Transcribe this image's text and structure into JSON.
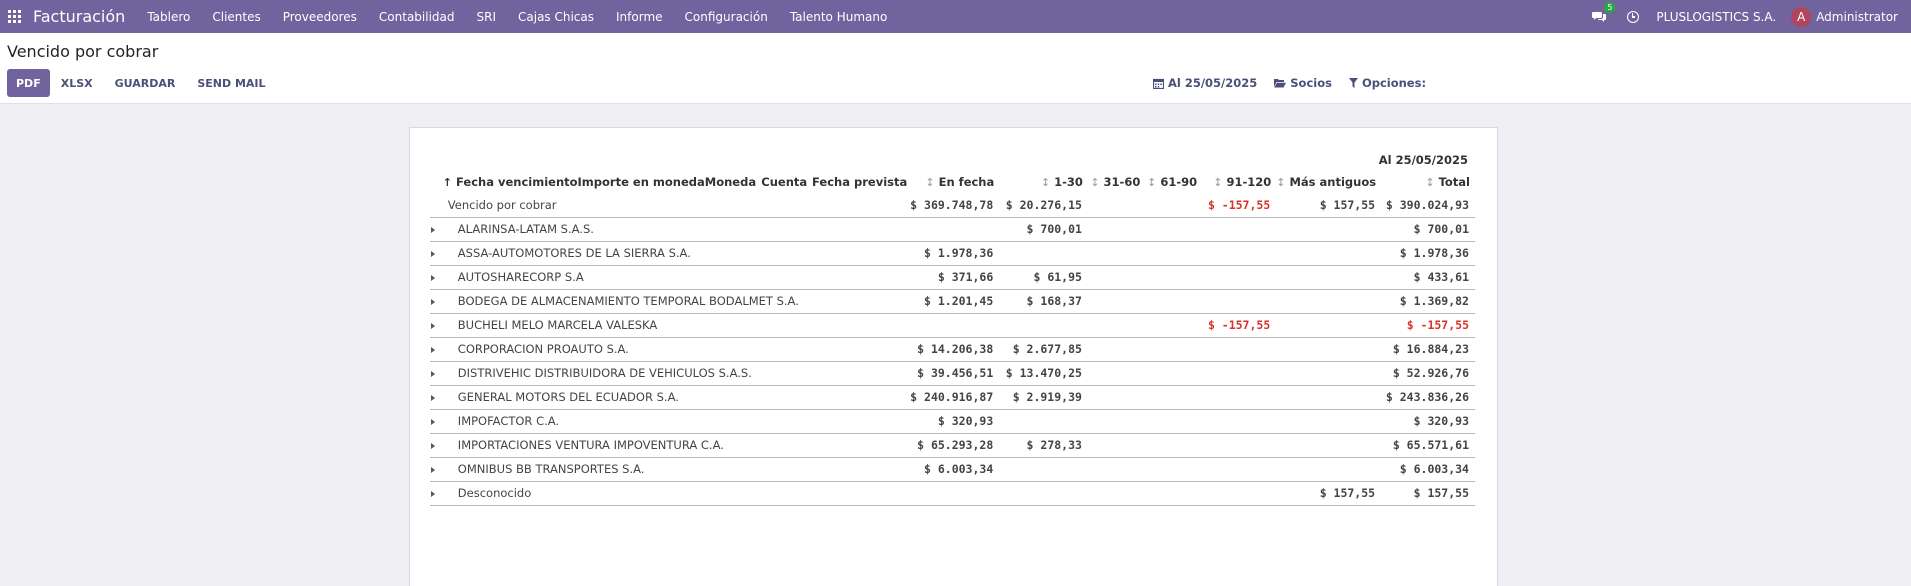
{
  "navbar": {
    "brand": "Facturación",
    "menu": [
      "Tablero",
      "Clientes",
      "Proveedores",
      "Contabilidad",
      "SRI",
      "Cajas Chicas",
      "Informe",
      "Configuración",
      "Talento Humano"
    ],
    "message_count": "5",
    "company": "PLUSLOGISTICS S.A.",
    "avatar_letter": "A",
    "user": "Administrator"
  },
  "control_panel": {
    "title": "Vencido por cobrar",
    "buttons": [
      "PDF",
      "XLSX",
      "GUARDAR",
      "SEND MAIL"
    ],
    "date_filter": "Al 25/05/2025",
    "partners_filter": "Socios",
    "options_filter": "Opciones:"
  },
  "report": {
    "as_of": "Al 25/05/2025",
    "columns": [
      "Fecha vencimiento",
      "Importe en moneda",
      "Moneda",
      "Cuenta",
      "Fecha prevista",
      "En fecha",
      "1-30",
      "31-60",
      "61-90",
      "91-120",
      "Más antiguos",
      "Total"
    ],
    "summary": {
      "name": "Vencido por cobrar",
      "values": [
        "$ 369.748,78",
        "$ 20.276,15",
        "",
        "",
        "$ -157,55",
        "$ 157,55",
        "$ 390.024,93"
      ]
    },
    "rows": [
      {
        "name": "ALARINSA-LATAM S.A.S.",
        "values": [
          "",
          "$ 700,01",
          "",
          "",
          "",
          "",
          "$ 700,01"
        ]
      },
      {
        "name": "ASSA-AUTOMOTORES DE LA SIERRA S.A.",
        "values": [
          "$ 1.978,36",
          "",
          "",
          "",
          "",
          "",
          "$ 1.978,36"
        ]
      },
      {
        "name": "AUTOSHARECORP S.A",
        "values": [
          "$ 371,66",
          "$ 61,95",
          "",
          "",
          "",
          "",
          "$ 433,61"
        ]
      },
      {
        "name": "BODEGA DE ALMACENAMIENTO TEMPORAL BODALMET S.A.",
        "values": [
          "$ 1.201,45",
          "$ 168,37",
          "",
          "",
          "",
          "",
          "$ 1.369,82"
        ]
      },
      {
        "name": "BUCHELI MELO MARCELA VALESKA",
        "values": [
          "",
          "",
          "",
          "",
          "$ -157,55",
          "",
          "$ -157,55"
        ]
      },
      {
        "name": "CORPORACION PROAUTO S.A.",
        "values": [
          "$ 14.206,38",
          "$ 2.677,85",
          "",
          "",
          "",
          "",
          "$ 16.884,23"
        ]
      },
      {
        "name": "DISTRIVEHIC DISTRIBUIDORA DE VEHICULOS S.A.S.",
        "values": [
          "$ 39.456,51",
          "$ 13.470,25",
          "",
          "",
          "",
          "",
          "$ 52.926,76"
        ]
      },
      {
        "name": "GENERAL MOTORS DEL ECUADOR S.A.",
        "values": [
          "$ 240.916,87",
          "$ 2.919,39",
          "",
          "",
          "",
          "",
          "$ 243.836,26"
        ]
      },
      {
        "name": "IMPOFACTOR C.A.",
        "values": [
          "$ 320,93",
          "",
          "",
          "",
          "",
          "",
          "$ 320,93"
        ]
      },
      {
        "name": "IMPORTACIONES VENTURA IMPOVENTURA C.A.",
        "values": [
          "$ 65.293,28",
          "$ 278,33",
          "",
          "",
          "",
          "",
          "$ 65.571,61"
        ]
      },
      {
        "name": "OMNIBUS BB TRANSPORTES S.A.",
        "values": [
          "$ 6.003,34",
          "",
          "",
          "",
          "",
          "",
          "$ 6.003,34"
        ]
      },
      {
        "name": "Desconocido",
        "values": [
          "",
          "",
          "",
          "",
          "",
          "$ 157,55",
          "$ 157,55"
        ]
      }
    ]
  },
  "colors": {
    "navbar": "#71639e",
    "primary": "#71639e",
    "negative": "#d9322b"
  }
}
